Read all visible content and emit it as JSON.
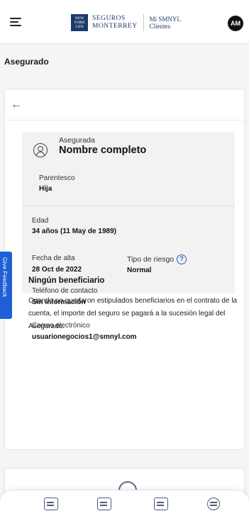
{
  "header": {
    "brand_logo_text": "NEW YORK LIFE",
    "brand_line1": "SEGUROS",
    "brand_line2": "MONTERREY",
    "portal_line1": "Mi SMNYL",
    "portal_line2": "Clientes",
    "avatar_initials": "AM"
  },
  "page": {
    "section_title": "Asegurado"
  },
  "insured": {
    "relation_label": "Asegurada",
    "name": "Nombre completo",
    "kinship_label": "Parentesco",
    "kinship_value": "Hija",
    "age_label": "Edad",
    "age_value": "34 años (11 May de 1989)",
    "start_label": "Fecha de alta",
    "start_value": "28 Oct de 2022",
    "risk_label": "Tipo de riesgo",
    "risk_value": "Normal",
    "phone_label": "Teléfono de contacto",
    "phone_value": "Sin Información",
    "email_label": "Correo electrónico",
    "email_value": "usuarionegocios1@smnyl.com"
  },
  "beneficiaries": {
    "title": "Ningún beneficiario",
    "text": "Cuando no quedaron estipulados beneficiarios en el contrato de la cuenta, el importe del seguro se pagará a la sucesión legal del Asegurado."
  },
  "feedback": {
    "label": "Give Feedback"
  },
  "colors": {
    "accent": "#1f5fbf",
    "brand": "#1b3a6b",
    "feedback": "#1f5fd6"
  }
}
